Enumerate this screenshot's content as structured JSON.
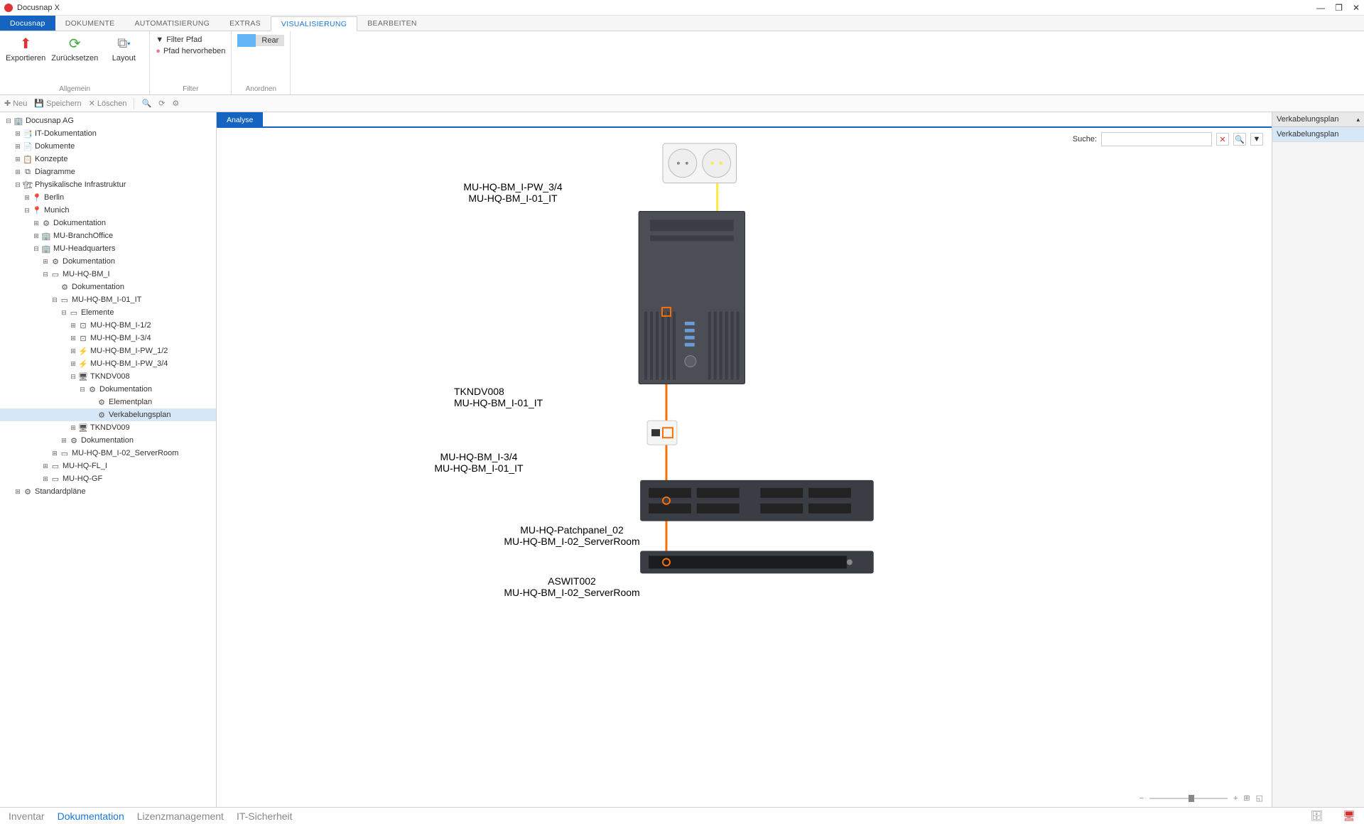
{
  "title": "Docusnap X",
  "menuTabs": [
    "Docusnap",
    "DOKUMENTE",
    "AUTOMATISIERUNG",
    "EXTRAS",
    "VISUALISIERUNG",
    "BEARBEITEN"
  ],
  "ribbon": {
    "allgemein": {
      "label": "Allgemein",
      "export": "Exportieren",
      "reset": "Zurücksetzen",
      "layout": "Layout"
    },
    "filter": {
      "label": "Filter",
      "filterPath": "Filter Pfad",
      "highlightPath": "Pfad hervorheben"
    },
    "anordnen": {
      "label": "Anordnen",
      "rear": "Rear"
    }
  },
  "toolbar2": {
    "new": "Neu",
    "save": "Speichern",
    "delete": "Löschen"
  },
  "tree": [
    {
      "d": 0,
      "t": "⊟",
      "i": "🏢",
      "l": "Docusnap AG"
    },
    {
      "d": 1,
      "t": "⊞",
      "i": "📑",
      "l": "IT-Dokumentation"
    },
    {
      "d": 1,
      "t": "⊞",
      "i": "📄",
      "l": "Dokumente"
    },
    {
      "d": 1,
      "t": "⊞",
      "i": "📋",
      "l": "Konzepte"
    },
    {
      "d": 1,
      "t": "⊞",
      "i": "⧉",
      "l": "Diagramme"
    },
    {
      "d": 1,
      "t": "⊟",
      "i": "🏗",
      "l": "Physikalische Infrastruktur"
    },
    {
      "d": 2,
      "t": "⊞",
      "i": "📍",
      "l": "Berlin"
    },
    {
      "d": 2,
      "t": "⊟",
      "i": "📍",
      "l": "Munich"
    },
    {
      "d": 3,
      "t": "⊞",
      "i": "⚙",
      "l": "Dokumentation"
    },
    {
      "d": 3,
      "t": "⊞",
      "i": "🏢",
      "l": "MU-BranchOffice"
    },
    {
      "d": 3,
      "t": "⊟",
      "i": "🏢",
      "l": "MU-Headquarters"
    },
    {
      "d": 4,
      "t": "⊞",
      "i": "⚙",
      "l": "Dokumentation"
    },
    {
      "d": 4,
      "t": "⊟",
      "i": "▭",
      "l": "MU-HQ-BM_I"
    },
    {
      "d": 5,
      "t": "",
      "i": "⚙",
      "l": "Dokumentation"
    },
    {
      "d": 5,
      "t": "⊟",
      "i": "▭",
      "l": "MU-HQ-BM_I-01_IT"
    },
    {
      "d": 6,
      "t": "⊟",
      "i": "▭",
      "l": "Elemente"
    },
    {
      "d": 7,
      "t": "⊞",
      "i": "⊡",
      "l": "MU-HQ-BM_I-1/2"
    },
    {
      "d": 7,
      "t": "⊞",
      "i": "⊡",
      "l": "MU-HQ-BM_I-3/4"
    },
    {
      "d": 7,
      "t": "⊞",
      "i": "⚡",
      "l": "MU-HQ-BM_I-PW_1/2"
    },
    {
      "d": 7,
      "t": "⊞",
      "i": "⚡",
      "l": "MU-HQ-BM_I-PW_3/4"
    },
    {
      "d": 7,
      "t": "⊟",
      "i": "🖥",
      "l": "TKNDV008"
    },
    {
      "d": 8,
      "t": "⊟",
      "i": "⚙",
      "l": "Dokumentation"
    },
    {
      "d": 9,
      "t": "",
      "i": "⚙",
      "l": "Elementplan"
    },
    {
      "d": 9,
      "t": "",
      "i": "⚙",
      "l": "Verkabelungsplan",
      "sel": true
    },
    {
      "d": 7,
      "t": "⊞",
      "i": "🖥",
      "l": "TKNDV009"
    },
    {
      "d": 6,
      "t": "⊞",
      "i": "⚙",
      "l": "Dokumentation"
    },
    {
      "d": 5,
      "t": "⊞",
      "i": "▭",
      "l": "MU-HQ-BM_I-02_ServerRoom"
    },
    {
      "d": 4,
      "t": "⊞",
      "i": "▭",
      "l": "MU-HQ-FL_I"
    },
    {
      "d": 4,
      "t": "⊞",
      "i": "▭",
      "l": "MU-HQ-GF"
    },
    {
      "d": 1,
      "t": "⊞",
      "i": "⚙",
      "l": "Standardpläne"
    }
  ],
  "canvasTab": "Analyse",
  "searchLabel": "Suche:",
  "diagram": {
    "outlet": {
      "l1": "MU-HQ-BM_I-PW_3/4",
      "l2": "MU-HQ-BM_I-01_IT"
    },
    "tower": {
      "l1": "TKNDV008",
      "l2": "MU-HQ-BM_I-01_IT"
    },
    "wallport": {
      "l1": "MU-HQ-BM_I-3/4",
      "l2": "MU-HQ-BM_I-01_IT"
    },
    "patch": {
      "l1": "MU-HQ-Patchpanel_02",
      "l2": "MU-HQ-BM_I-02_ServerRoom"
    },
    "switch": {
      "l1": "ASWIT002",
      "l2": "MU-HQ-BM_I-02_ServerRoom"
    }
  },
  "rightPanel": {
    "header": "Verkabelungsplan",
    "item": "Verkabelungsplan"
  },
  "bottomNav": [
    "Inventar",
    "Dokumentation",
    "Lizenzmanagement",
    "IT-Sicherheit"
  ]
}
